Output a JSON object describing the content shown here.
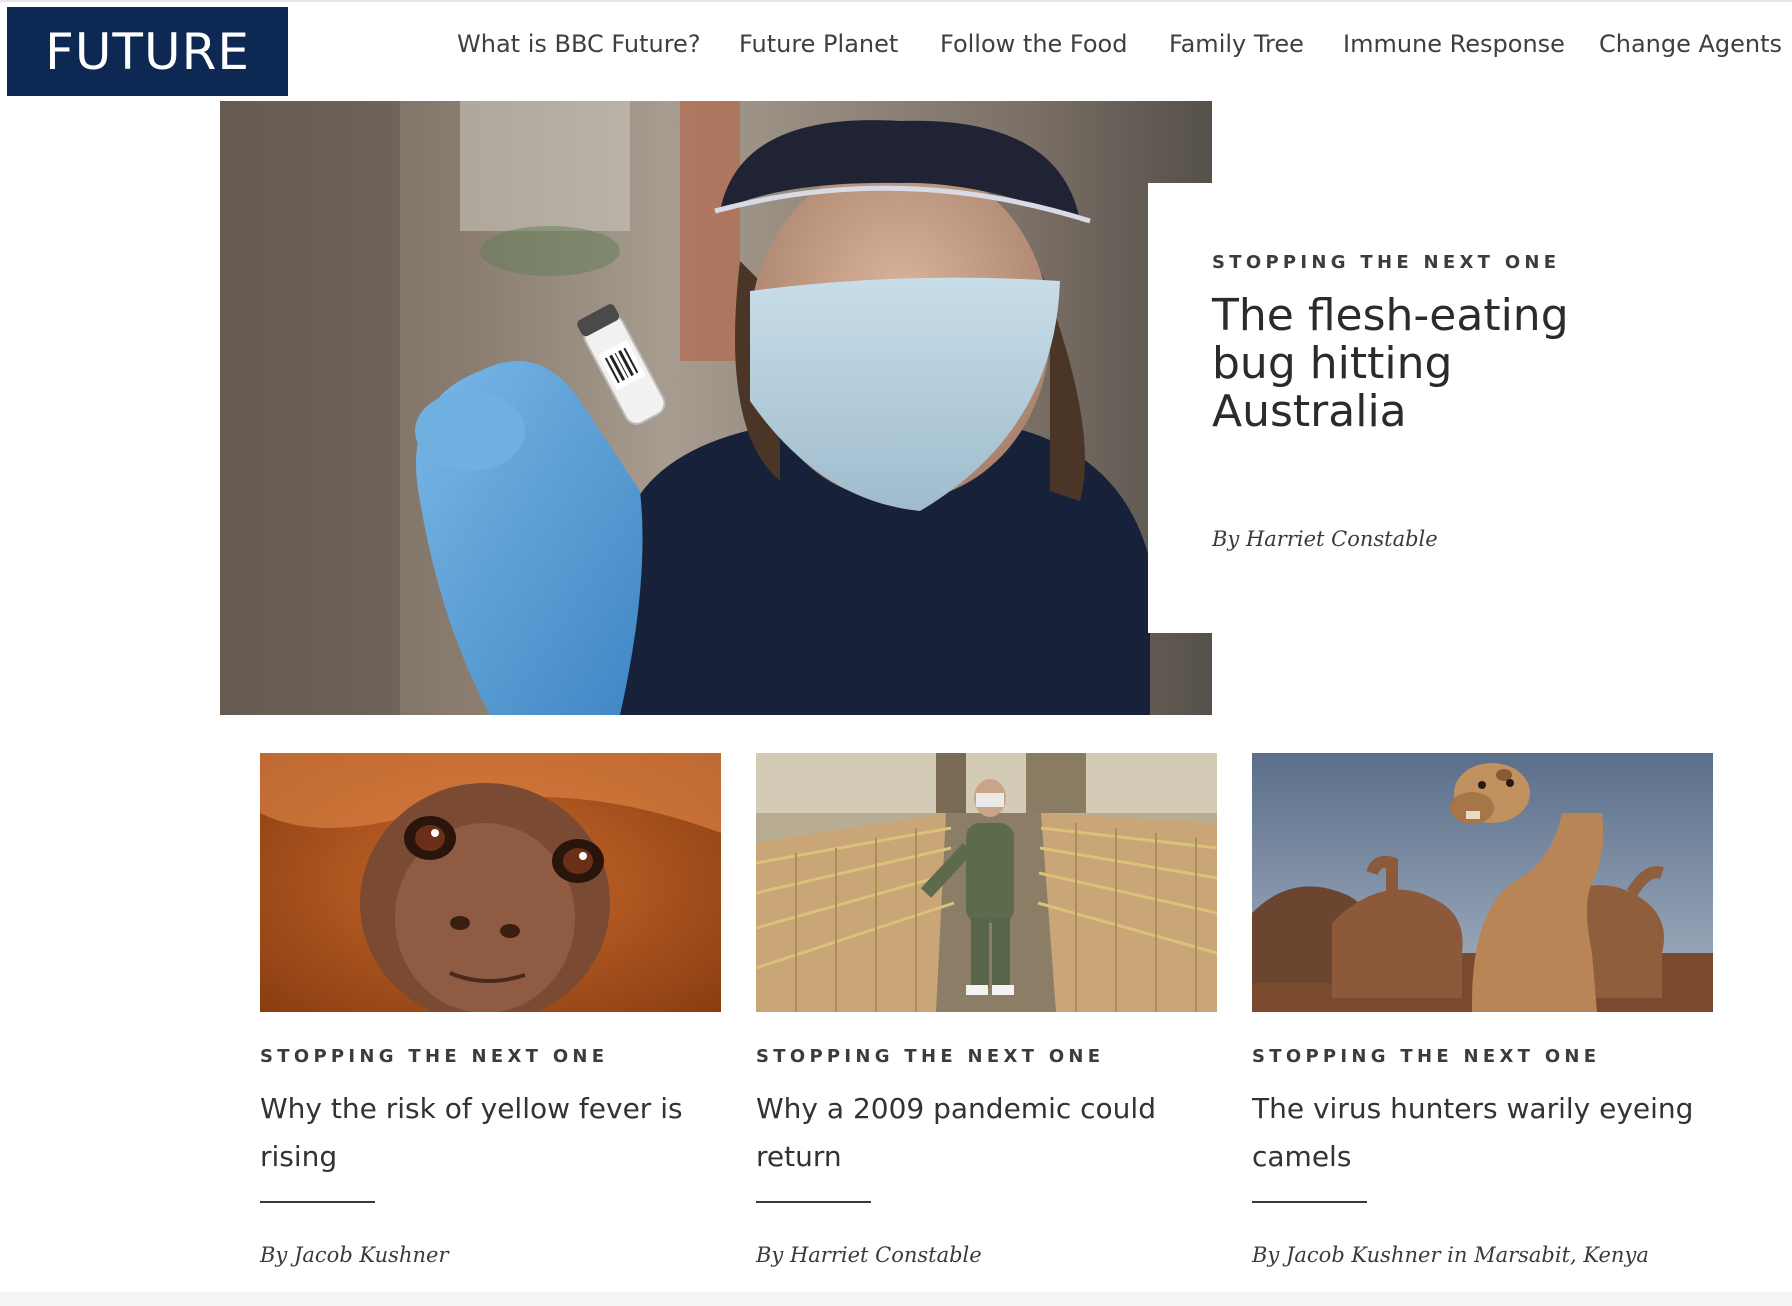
{
  "brand": {
    "logo_text": "FUTURE"
  },
  "nav": {
    "items": [
      {
        "label": "What is BBC Future?"
      },
      {
        "label": "Future Planet"
      },
      {
        "label": "Follow the Food"
      },
      {
        "label": "Family Tree"
      },
      {
        "label": "Immune Response"
      },
      {
        "label": "Change Agents"
      }
    ]
  },
  "hero": {
    "kicker": "STOPPING THE NEXT ONE",
    "title": "The flesh-eating bug hitting Australia",
    "byline": "By Harriet Constable"
  },
  "cards": [
    {
      "kicker": "STOPPING THE NEXT ONE",
      "title": "Why the risk of yellow fever is rising",
      "byline": "By Jacob Kushner"
    },
    {
      "kicker": "STOPPING THE NEXT ONE",
      "title": "Why a 2009 pandemic could return",
      "byline": "By Harriet Constable"
    },
    {
      "kicker": "STOPPING THE NEXT ONE",
      "title": "The virus hunters warily eyeing camels",
      "byline": "By Jacob Kushner in Marsabit, Kenya"
    }
  ],
  "colors": {
    "brand_navy": "#0c2853",
    "text": "#3a3a3a"
  }
}
